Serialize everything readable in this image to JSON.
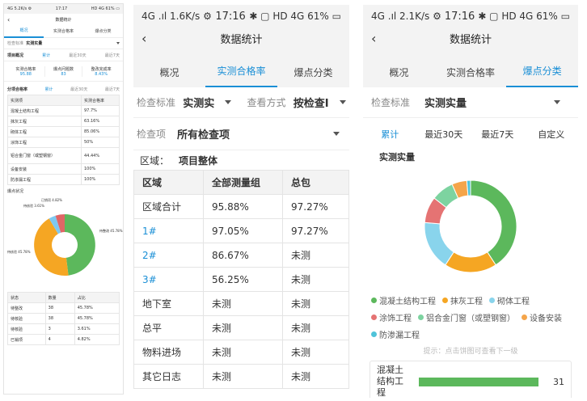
{
  "p1": {
    "status": {
      "left": "4G 5.2K/s ⚙",
      "time": "17:17",
      "right": "HD 4G 61% ▭"
    },
    "title": "数据统计",
    "tabs": [
      "概况",
      "实测合格率",
      "爆点分类"
    ],
    "standard_label": "检查标准",
    "standard_value": "实测实量",
    "overview_title": "项目概况",
    "periods": [
      "累计",
      "最近30天",
      "最近7天"
    ],
    "overview": [
      {
        "label": "实测合格率",
        "value": "95.88"
      },
      {
        "label": "爆点问题数",
        "value": "83"
      },
      {
        "label": "整改完成率",
        "value": "8.43%"
      }
    ],
    "sub_title": "分项合格率",
    "pass_table": {
      "headers": [
        "实测项",
        "实测合格率"
      ],
      "rows": [
        [
          "混凝土结构工程",
          "97.7%"
        ],
        [
          "抹灰工程",
          "63.16%"
        ],
        [
          "砌体工程",
          "85.06%"
        ],
        [
          "涂饰工程",
          "50%"
        ],
        [
          "铝合金门窗（或塑钢窗）",
          "44.44%"
        ],
        [
          "设备安装",
          "100%"
        ],
        [
          "防渗漏工程",
          "100%"
        ]
      ]
    },
    "pie_title": "爆点状况",
    "pie_labels": {
      "a": "已销项 4.82%",
      "b": "待核验 3.61%",
      "c": "待整改 45.78%",
      "d": "待核验 45.78%"
    },
    "status_table": {
      "headers": [
        "状态",
        "数量",
        "占比"
      ],
      "rows": [
        [
          "待整改",
          "38",
          "45.78%"
        ],
        [
          "待核验",
          "38",
          "45.78%"
        ],
        [
          "待核验",
          "3",
          "3.61%"
        ],
        [
          "已销项",
          "4",
          "4.82%"
        ]
      ]
    },
    "colors": {
      "green": "#5cb85c",
      "orange": "#f5a623",
      "blue": "#7ec9f1",
      "red": "#e06666"
    }
  },
  "p2": {
    "status": {
      "left": "4G .ıl 1.6K/s ⚙",
      "time": "17:16",
      "right": "✱ ▢ HD 4G 61% ▭"
    },
    "title": "数据统计",
    "tabs": [
      "概况",
      "实测合格率",
      "爆点分类"
    ],
    "f1_label": "检查标准",
    "f1_value": "实测实",
    "f2_label": "查看方式",
    "f2_value": "按检查I",
    "f3_label": "检查项",
    "f3_value": "所有检查项",
    "region_label": "区域：",
    "region_value": "项目整体",
    "table": {
      "headers": [
        "区域",
        "全部测量组",
        "总包"
      ],
      "rows": [
        [
          "区域合计",
          "95.88%",
          "97.27%"
        ],
        [
          "1#",
          "97.05%",
          "97.27%"
        ],
        [
          "2#",
          "86.67%",
          "未测"
        ],
        [
          "3#",
          "56.25%",
          "未测"
        ],
        [
          "地下室",
          "未测",
          "未测"
        ],
        [
          "总平",
          "未测",
          "未测"
        ],
        [
          "物料进场",
          "未测",
          "未测"
        ],
        [
          "其它日志",
          "未测",
          "未测"
        ]
      ]
    }
  },
  "p3": {
    "status": {
      "left": "4G .ıl 2.1K/s ⚙",
      "time": "17:16",
      "right": "✱ ▢ HD 4G 61% ▭"
    },
    "title": "数据统计",
    "tabs": [
      "概况",
      "实测合格率",
      "爆点分类"
    ],
    "f1_label": "检查标准",
    "f1_value": "实测实量",
    "periods": [
      "累计",
      "最近30天",
      "最近7天",
      "自定义"
    ],
    "chart_title": "实测实量",
    "legend": [
      "混凝土结构工程",
      "抹灰工程",
      "砌体工程",
      "涂饰工程",
      "铝合金门窗（或塑钢窗）",
      "设备安装",
      "防渗漏工程"
    ],
    "legend_colors": [
      "#5cb85c",
      "#f5a623",
      "#89d4ec",
      "#e57373",
      "#7dd3a0",
      "#f5a54a",
      "#4fc3d9"
    ],
    "hint": "提示：点击饼图可查看下一级",
    "bar_label": "混凝土结构工程",
    "bar_value": "31"
  },
  "chart_data": {
    "type": "pie",
    "title": "实测实量",
    "categories": [
      "混凝土结构工程",
      "抹灰工程",
      "砌体工程",
      "涂饰工程",
      "铝合金门窗（或塑钢窗）",
      "设备安装",
      "防渗漏工程"
    ],
    "values": [
      31,
      14,
      13,
      7,
      6,
      4,
      1
    ]
  }
}
